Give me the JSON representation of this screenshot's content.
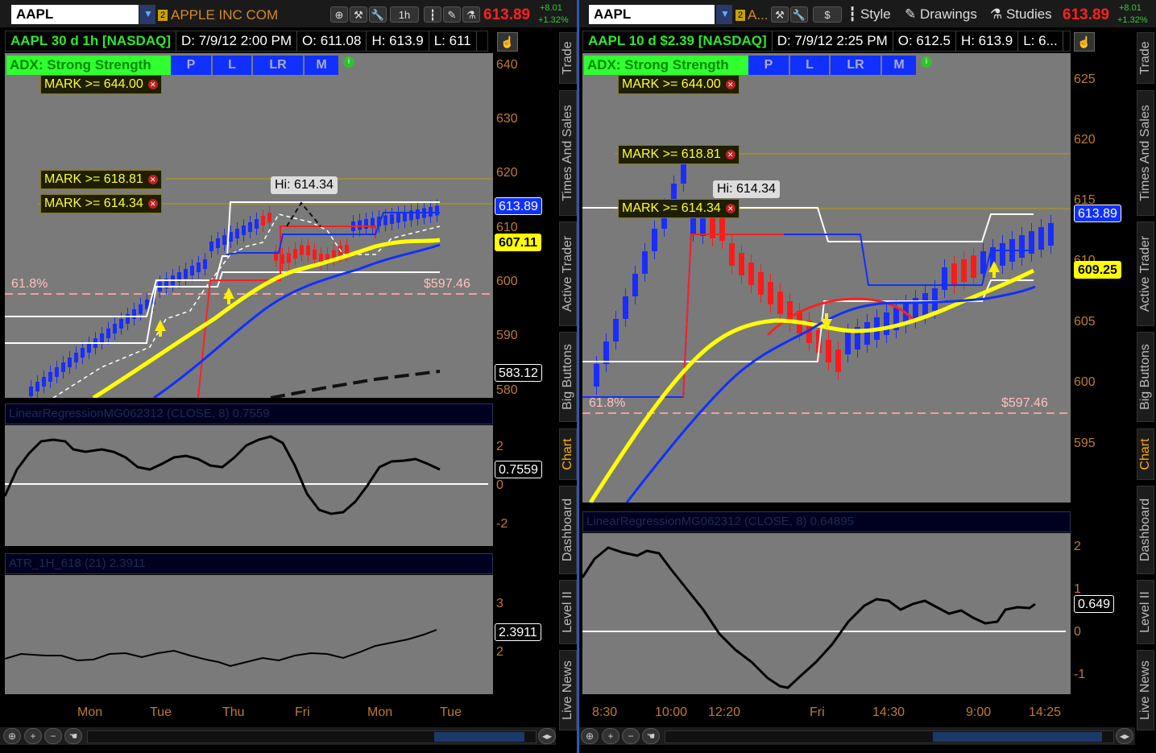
{
  "left": {
    "symbol": "AAPL",
    "company": "APPLE INC COM",
    "period_btn": "1h",
    "last_price": "613.89",
    "change": "+8.01",
    "change_pct": "+1.32%",
    "info": {
      "title": "AAPL 30 d 1h [NASDAQ]",
      "date": "D: 7/9/12 2:00 PM",
      "open": "O: 611.08",
      "high": "H: 613.9",
      "low": "L: 611"
    },
    "adx": "ADX:  Strong Strength",
    "mode_buttons": [
      "P",
      "L",
      "LR",
      "M"
    ],
    "marks": [
      "MARK >= 644.00",
      "MARK >= 618.81",
      "MARK >= 614.34"
    ],
    "hi_label": "Hi: 614.34",
    "fib_label": "61.8%",
    "fib_price": "$597.46",
    "y_ticks": [
      "640",
      "630",
      "620",
      "610",
      "600",
      "590",
      "580"
    ],
    "price_labels": {
      "last": "613.89",
      "yellow": "607.11",
      "lower": "583.12"
    },
    "study1_title": "LinearRegressionMG062312 (CLOSE, 8)",
    "study1_value": "0.7559",
    "study1_ticks": [
      "2",
      "0",
      "-2"
    ],
    "study2_title": "ATR_1H_618 (21)",
    "study2_value": "2.3911",
    "study2_ticks": [
      "3",
      "2"
    ],
    "x_labels": [
      "Mon",
      "Tue",
      "Thu",
      "Fri",
      "Mon",
      "Tue"
    ]
  },
  "right": {
    "symbol": "AAPL",
    "company": "A...",
    "dollar_btn": "$",
    "menu": [
      "Style",
      "Drawings",
      "Studies"
    ],
    "last_price": "613.89",
    "change": "+8.01",
    "change_pct": "+1.32%",
    "info": {
      "title": "AAPL 10 d $2.39 [NASDAQ]",
      "date": "D: 7/9/12 2:25 PM",
      "open": "O: 612.5",
      "high": "H: 613.9",
      "low": "L: 6..."
    },
    "adx": "ADX:  Strong Strength",
    "mode_buttons": [
      "P",
      "L",
      "LR",
      "M"
    ],
    "marks": [
      "MARK >= 644.00",
      "MARK >= 618.81",
      "MARK >= 614.34"
    ],
    "hi_label": "Hi: 614.34",
    "fib_label": "61.8%",
    "fib_price": "$597.46",
    "y_ticks": [
      "625",
      "620",
      "615",
      "610",
      "605",
      "600",
      "595"
    ],
    "price_labels": {
      "last": "613.89",
      "yellow": "609.25"
    },
    "study1_title": "LinearRegressionMG062312 (CLOSE, 8)",
    "study1_value": "0.64895",
    "study1_value_label": "0.649",
    "study1_ticks": [
      "2",
      "1",
      "0",
      "-1"
    ],
    "x_labels": [
      "8:30",
      "10:00",
      "12:20",
      "Fri",
      "14:30",
      "9:00",
      "14:25"
    ]
  },
  "side_tabs": [
    "Trade",
    "Times And Sales",
    "Active Trader",
    "Big Buttons",
    "Chart",
    "Dashboard",
    "Level II",
    "Live News"
  ],
  "colors": {
    "up": "#1a2cff",
    "down": "#ff1a1a",
    "ema_yellow": "#ffff00",
    "accent_orange": "#d98a1e"
  }
}
